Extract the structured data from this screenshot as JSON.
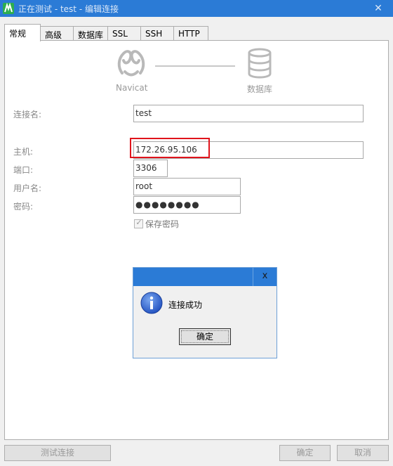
{
  "window": {
    "title": "正在测试 - test - 编辑连接",
    "close_glyph": "✕"
  },
  "tabs": [
    {
      "label": "常规",
      "active": true
    },
    {
      "label": "高级"
    },
    {
      "label": "数据库"
    },
    {
      "label": "SSL"
    },
    {
      "label": "SSH"
    },
    {
      "label": "HTTP"
    }
  ],
  "diagram": {
    "left_caption": "Navicat",
    "right_caption": "数据库"
  },
  "form": {
    "connection_name": {
      "label": "连接名:",
      "value": "test"
    },
    "host": {
      "label": "主机:",
      "value": "172.26.95.106"
    },
    "port": {
      "label": "端口:",
      "value": "3306"
    },
    "username": {
      "label": "用户名:",
      "value": "root"
    },
    "password": {
      "label": "密码:",
      "value": "●●●●●●●●"
    },
    "save_password": {
      "label": "保存密码",
      "checked": true,
      "check_glyph": "✓"
    }
  },
  "dialog": {
    "close_glyph": "x",
    "message": "连接成功",
    "ok_label": "确定"
  },
  "footer": {
    "test_label": "测试连接",
    "ok_label": "确定",
    "cancel_label": "取消"
  },
  "colors": {
    "title_bar": "#2b7bd6",
    "app_icon": "#2eae4f",
    "highlight": "#e0141c",
    "info_icon": "#1f4fbf"
  }
}
